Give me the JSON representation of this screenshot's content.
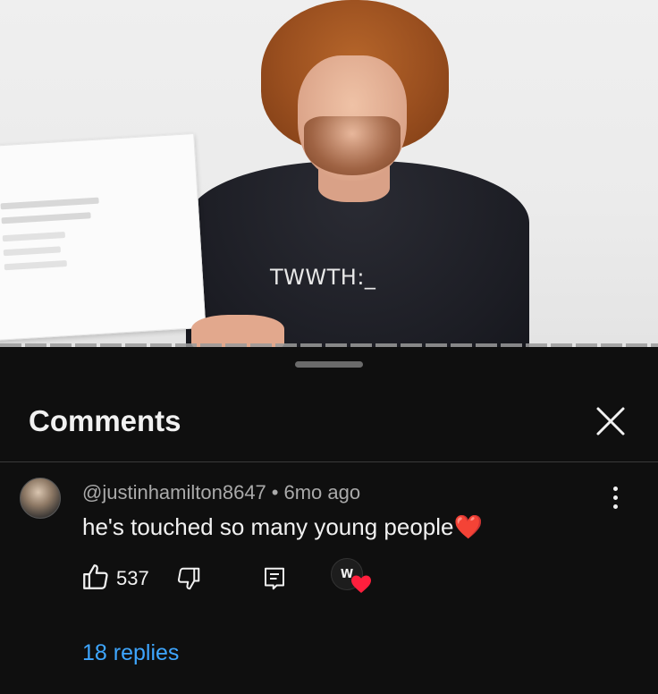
{
  "video": {
    "shirt_text": "TWWTH:_"
  },
  "comments_panel": {
    "title": "Comments",
    "close_icon": "close-icon"
  },
  "comment": {
    "author": "@justinhamilton8647",
    "separator": "•",
    "time": "6mo ago",
    "text": "he's touched so many young people",
    "text_emoji": "❤️",
    "like_count": "537",
    "creator_avatar_text": "W",
    "replies_label": "18 replies"
  },
  "colors": {
    "background": "#0f0f0f",
    "link_blue": "#3ea6ff",
    "heart_red": "#ff1f3d",
    "secondary_text": "#aaaaaa"
  }
}
